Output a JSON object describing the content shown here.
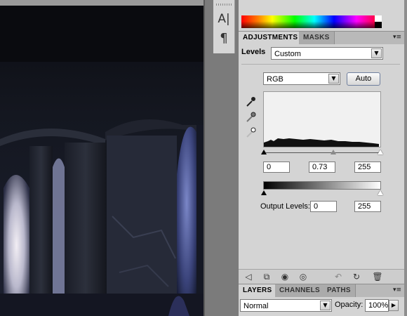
{
  "toolstrip": {
    "character_icon": "A|",
    "paragraph_icon": "¶"
  },
  "adjustments_panel": {
    "tabs": [
      "ADJUSTMENTS",
      "MASKS"
    ],
    "menu_icon": "▾≡",
    "levels_label": "Levels",
    "preset_value": "Custom",
    "channel_value": "RGB",
    "auto_button": "Auto",
    "input_black": "0",
    "input_gamma": "0.73",
    "input_white": "255",
    "output_label": "Output Levels:",
    "output_black": "0",
    "output_white": "255",
    "icons": [
      "back-arrow-icon",
      "clip-layer-icon",
      "visibility-eye-icon",
      "view-previous-eye-icon",
      "reset-icon",
      "refresh-icon",
      "trash-icon"
    ]
  },
  "layers_panel": {
    "tabs": [
      "LAYERS",
      "CHANNELS",
      "PATHS"
    ],
    "blend_mode": "Normal",
    "opacity_label": "Opacity:",
    "opacity_value": "100%"
  },
  "colors": {
    "panel_bg": "#d4d4d4",
    "tab_bg": "#b9b9b9",
    "workspace": "#7b7b7b"
  }
}
